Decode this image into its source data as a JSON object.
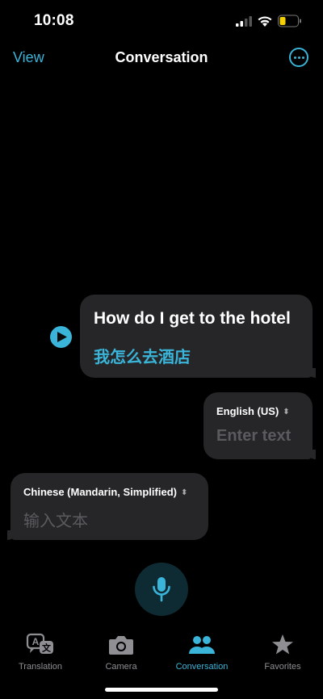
{
  "status": {
    "time": "10:08"
  },
  "nav": {
    "left": "View",
    "title": "Conversation"
  },
  "conversation": {
    "source_text": "How do I get to the hotel",
    "translated_text": "我怎么去酒店"
  },
  "english_panel": {
    "language": "English (US)",
    "placeholder": "Enter text"
  },
  "chinese_panel": {
    "language": "Chinese (Mandarin, Simplified)",
    "placeholder": "输入文本"
  },
  "tabs": [
    {
      "label": "Translation",
      "icon": "translation-icon",
      "active": false
    },
    {
      "label": "Camera",
      "icon": "camera-icon",
      "active": false
    },
    {
      "label": "Conversation",
      "icon": "people-icon",
      "active": true
    },
    {
      "label": "Favorites",
      "icon": "star-icon",
      "active": false
    }
  ],
  "colors": {
    "accent": "#3ab4d8",
    "bubble": "#262628",
    "background": "#000000"
  }
}
